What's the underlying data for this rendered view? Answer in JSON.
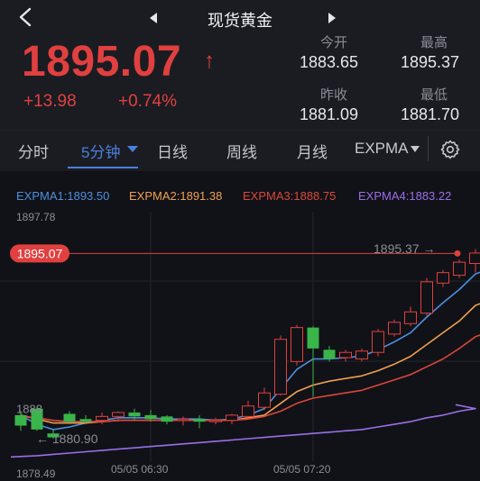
{
  "header": {
    "title": "现货黄金"
  },
  "quote": {
    "price": "1895.07",
    "change": "+13.98",
    "change_pct": "+0.74%",
    "stats": [
      {
        "label": "今开",
        "value": "1883.65"
      },
      {
        "label": "最高",
        "value": "1895.37"
      },
      {
        "label": "昨收",
        "value": "1881.09"
      },
      {
        "label": "最低",
        "value": "1881.70"
      }
    ]
  },
  "tabs": [
    {
      "label": "分时"
    },
    {
      "label": "5分钟"
    },
    {
      "label": "日线"
    },
    {
      "label": "周线"
    },
    {
      "label": "月线"
    },
    {
      "label": "EXPMA"
    }
  ],
  "colors": {
    "up": "#e0403f",
    "down": "#39b54a",
    "accent": "#4a7fe0",
    "ema1": "#4a90e2",
    "ema2": "#f0a050",
    "ema3": "#d9473a",
    "ema4": "#9a6ee8"
  },
  "chart_data": {
    "type": "candlestick",
    "legend": [
      "EXPMA1:1893.50",
      "EXPMA2:1891.38",
      "EXPMA3:1888.75",
      "EXPMA4:1883.22"
    ],
    "y_top_label": "1897.78",
    "y_bottom_label": "1878.49",
    "ylim": [
      1878.49,
      1897.78
    ],
    "x_tick_labels": [
      "05/05 06:30",
      "05/05 07:20"
    ],
    "x_tick_index": [
      8,
      18
    ],
    "current_price_tag": "1895.07",
    "current_price": 1895.07,
    "high_marker": "1895.37",
    "high_marker_value": 1895.37,
    "low_marker": "1880.90",
    "low_marker_value": 1880.9,
    "left_cut_label": "1888",
    "left_cut_value": 1883.2,
    "candles": [
      {
        "o": 1882.7,
        "h": 1883.0,
        "l": 1881.5,
        "c": 1881.9
      },
      {
        "o": 1883.2,
        "h": 1883.3,
        "l": 1881.5,
        "c": 1881.6
      },
      {
        "o": 1881.3,
        "h": 1881.6,
        "l": 1880.9,
        "c": 1881.0
      },
      {
        "o": 1882.8,
        "h": 1883.0,
        "l": 1882.0,
        "c": 1882.2
      },
      {
        "o": 1882.4,
        "h": 1882.7,
        "l": 1882.0,
        "c": 1882.2
      },
      {
        "o": 1882.3,
        "h": 1882.9,
        "l": 1882.0,
        "c": 1882.6
      },
      {
        "o": 1882.6,
        "h": 1883.0,
        "l": 1882.2,
        "c": 1882.9
      },
      {
        "o": 1882.9,
        "h": 1883.2,
        "l": 1882.3,
        "c": 1882.6
      },
      {
        "o": 1882.7,
        "h": 1883.1,
        "l": 1882.2,
        "c": 1882.4
      },
      {
        "o": 1882.6,
        "h": 1882.7,
        "l": 1882.0,
        "c": 1882.2
      },
      {
        "o": 1882.3,
        "h": 1882.6,
        "l": 1881.9,
        "c": 1882.4
      },
      {
        "o": 1882.4,
        "h": 1882.7,
        "l": 1881.7,
        "c": 1882.2
      },
      {
        "o": 1882.2,
        "h": 1882.5,
        "l": 1882.0,
        "c": 1882.3
      },
      {
        "o": 1882.3,
        "h": 1882.8,
        "l": 1882.0,
        "c": 1882.7
      },
      {
        "o": 1882.6,
        "h": 1883.8,
        "l": 1882.4,
        "c": 1883.4
      },
      {
        "o": 1883.3,
        "h": 1884.8,
        "l": 1883.1,
        "c": 1884.4
      },
      {
        "o": 1884.3,
        "h": 1888.8,
        "l": 1884.2,
        "c": 1888.5
      },
      {
        "o": 1886.8,
        "h": 1889.6,
        "l": 1886.5,
        "c": 1889.4
      },
      {
        "o": 1889.4,
        "h": 1889.5,
        "l": 1884.1,
        "c": 1887.8
      },
      {
        "o": 1887.7,
        "h": 1888.0,
        "l": 1886.8,
        "c": 1887.0
      },
      {
        "o": 1887.1,
        "h": 1887.7,
        "l": 1886.8,
        "c": 1887.5
      },
      {
        "o": 1887.0,
        "h": 1887.8,
        "l": 1886.8,
        "c": 1887.6
      },
      {
        "o": 1887.5,
        "h": 1889.3,
        "l": 1887.2,
        "c": 1889.1
      },
      {
        "o": 1888.9,
        "h": 1890.0,
        "l": 1888.7,
        "c": 1889.8
      },
      {
        "o": 1889.7,
        "h": 1891.0,
        "l": 1889.5,
        "c": 1890.6
      },
      {
        "o": 1890.5,
        "h": 1893.2,
        "l": 1890.3,
        "c": 1892.9
      },
      {
        "o": 1892.8,
        "h": 1893.8,
        "l": 1892.5,
        "c": 1893.6
      },
      {
        "o": 1893.4,
        "h": 1894.6,
        "l": 1893.2,
        "c": 1894.4
      },
      {
        "o": 1894.3,
        "h": 1895.4,
        "l": 1893.6,
        "c": 1895.1
      }
    ],
    "ema_series": [
      {
        "name": "EXPMA1",
        "values": [
          1882.7,
          1882.0,
          1881.6,
          1881.8,
          1882.1,
          1882.3,
          1882.5,
          1882.5,
          1882.5,
          1882.4,
          1882.4,
          1882.4,
          1882.3,
          1882.4,
          1882.7,
          1883.2,
          1884.7,
          1886.2,
          1887.0,
          1887.0,
          1887.1,
          1887.2,
          1887.7,
          1888.3,
          1889.0,
          1890.2,
          1891.3,
          1892.3,
          1893.5
        ]
      },
      {
        "name": "EXPMA2",
        "values": [
          1882.7,
          1882.4,
          1882.1,
          1882.1,
          1882.1,
          1882.2,
          1882.3,
          1882.3,
          1882.3,
          1882.3,
          1882.3,
          1882.3,
          1882.3,
          1882.3,
          1882.5,
          1882.7,
          1883.6,
          1884.5,
          1885.0,
          1885.3,
          1885.5,
          1885.7,
          1886.1,
          1886.6,
          1887.2,
          1888.1,
          1889.0,
          1889.9,
          1891.1
        ]
      },
      {
        "name": "EXPMA3",
        "values": [
          1882.6,
          1882.5,
          1882.3,
          1882.2,
          1882.2,
          1882.2,
          1882.3,
          1882.3,
          1882.3,
          1882.3,
          1882.3,
          1882.3,
          1882.3,
          1882.3,
          1882.4,
          1882.6,
          1883.0,
          1883.6,
          1884.0,
          1884.2,
          1884.4,
          1884.6,
          1885.0,
          1885.4,
          1885.8,
          1886.4,
          1887.0,
          1887.8,
          1888.7
        ]
      },
      {
        "name": "EXPMA4",
        "values": [
          1879.5,
          1879.6,
          1879.7,
          1879.8,
          1879.9,
          1880.0,
          1880.1,
          1880.2,
          1880.3,
          1880.4,
          1880.5,
          1880.6,
          1880.7,
          1880.8,
          1880.9,
          1881.0,
          1881.1,
          1881.2,
          1881.3,
          1881.4,
          1881.5,
          1881.6,
          1881.8,
          1882.0,
          1882.2,
          1882.5,
          1882.7,
          1883.0,
          1883.2
        ]
      }
    ]
  }
}
